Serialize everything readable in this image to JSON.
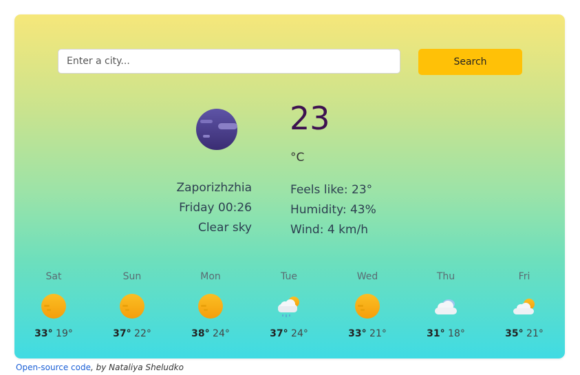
{
  "search": {
    "placeholder": "Enter a city...",
    "button_label": "Search"
  },
  "current": {
    "icon": "night-clear-moon-icon",
    "temperature": "23",
    "unit": "°C",
    "city": "Zaporizhzhia",
    "datetime": "Friday 00:26",
    "description": "Clear sky",
    "feels_like": "Feels like: 23°",
    "humidity": "Humidity: 43%",
    "wind": "Wind: 4 km/h"
  },
  "forecast": [
    {
      "day": "Sat",
      "icon": "sun-icon",
      "max": "33°",
      "min": "19°"
    },
    {
      "day": "Sun",
      "icon": "sun-icon",
      "max": "37°",
      "min": "22°"
    },
    {
      "day": "Mon",
      "icon": "sun-icon",
      "max": "38°",
      "min": "24°"
    },
    {
      "day": "Tue",
      "icon": "cloud-rain-sun-icon",
      "max": "37°",
      "min": "24°"
    },
    {
      "day": "Wed",
      "icon": "sun-icon",
      "max": "33°",
      "min": "21°"
    },
    {
      "day": "Thu",
      "icon": "cloud-icon",
      "max": "31°",
      "min": "18°"
    },
    {
      "day": "Fri",
      "icon": "cloud-sun-icon",
      "max": "35°",
      "min": "21°"
    }
  ],
  "footer": {
    "link_text": "Open-source code",
    "author_text": ", by Nataliya Sheludko"
  },
  "colors": {
    "accent": "#ffc107",
    "temperature": "#3d1150",
    "gradient_top": "#f6e77a",
    "gradient_bottom": "#40dbe3",
    "link": "#1a5fd6"
  }
}
